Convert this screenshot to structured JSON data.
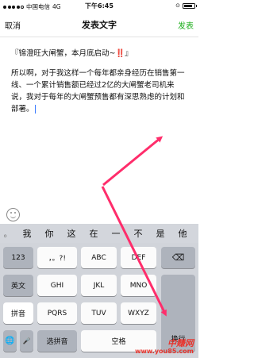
{
  "status_bar": {
    "carrier": "中国电信",
    "network": "4G",
    "time": "下午6:45",
    "battery_level": 0.85
  },
  "nav": {
    "cancel_label": "取消",
    "title": "发表文字",
    "publish_label": "发表"
  },
  "editor": {
    "quote_text": "『锦澄旺大闸蟹，本月底启动~",
    "quote_bang": "‼️",
    "quote_end": "』",
    "body_text": "所以啊，对于我这样一个每年都亲身经历在销售第一线、一个累计销售额已经过2亿的大闸蟹老司机来说，我对于每年的大闸蟹预售都有深思熟虑的计划和部署。"
  },
  "candidates": {
    "first": "。",
    "items": [
      "我",
      "你",
      "这",
      "在",
      "一",
      "不",
      "是",
      "他"
    ]
  },
  "keyboard": {
    "row1": [
      "123",
      "，。?!",
      "ABC",
      "DEF",
      "⌫"
    ],
    "row2": [
      "英文",
      "GHI",
      "JKL",
      "MNO"
    ],
    "row3": [
      "拼音",
      "PQRS",
      "TUV",
      "WXYZ"
    ],
    "row4": [
      "🌐",
      "🎤",
      "选拼音",
      "空格"
    ],
    "return_label": "换行"
  },
  "watermark": {
    "line1": "中赚网",
    "line2": "www.you85.com"
  },
  "colors": {
    "accent_green": "#1aad19",
    "annotation": "#ff2d6b",
    "watermark": "#e8352e"
  }
}
